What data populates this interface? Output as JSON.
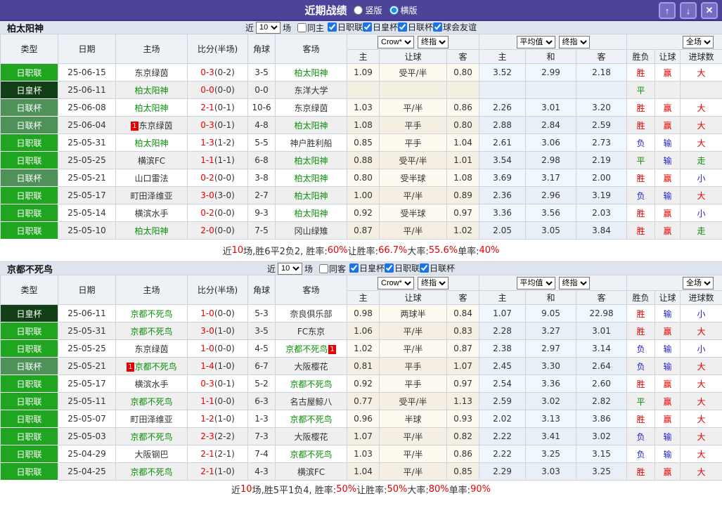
{
  "titlebar": {
    "title": "近期战绩",
    "vertical": {
      "label": "竖版",
      "checked": false
    },
    "horizontal": {
      "label": "横版",
      "checked": true
    },
    "buttons": {
      "up": "↑",
      "down": "↓",
      "close": "✕"
    }
  },
  "filter": {
    "prefix": "近",
    "count": "10",
    "suffix": "场"
  },
  "columns": {
    "type": "类型",
    "date": "日期",
    "home": "主场",
    "score": "比分(半场)",
    "corner": "角球",
    "away": "客场",
    "h": "主",
    "handicap": "让球",
    "a": "客",
    "h2": "主",
    "d": "和",
    "a2": "客",
    "result": "胜负",
    "handicap2": "让球",
    "goals": "进球数"
  },
  "dropdowns": {
    "odds_provider": "Crow*",
    "odds_final": "终指",
    "avg": "平均值",
    "avg_final": "终指",
    "fulltime": "全场"
  },
  "league_colors": {
    "日职联": "#1fa51f",
    "日皇杯": "#123f16",
    "日联杯": "#4e9159"
  },
  "colors": {
    "titlebar_purple": "#4d4399",
    "accent_blue": "#1a73e8",
    "win_red": "#e60000",
    "lose_blue": "#2222cc",
    "draw_green": "#0a8f0a",
    "odds_handicap_bg": "#fffaf0",
    "odds_europe_bg": "#f0f8ff"
  },
  "sections": [
    {
      "team": "柏太阳神",
      "same_label": "同主",
      "leagues": [
        "日职联",
        "日皇杯",
        "日联杯",
        "球会友谊"
      ],
      "rows": [
        {
          "lg": "日职联",
          "date": "25-06-15",
          "home": {
            "name": "东京绿茵",
            "focus": false
          },
          "score": "0-3",
          "half": "(0-2)",
          "corner": "3-5",
          "away": {
            "name": "柏太阳神",
            "focus": true
          },
          "o1": [
            "1.09",
            "受平/半",
            "0.80"
          ],
          "o2": [
            "3.52",
            "2.99",
            "2.18"
          ],
          "res": {
            "t": "胜",
            "c": "red"
          },
          "han": {
            "t": "赢",
            "c": "red"
          },
          "gl": {
            "t": "大",
            "c": "red"
          }
        },
        {
          "lg": "日皇杯",
          "date": "25-06-11",
          "home": {
            "name": "柏太阳神",
            "focus": true
          },
          "score": "0-0",
          "half": "(0-0)",
          "corner": "0-0",
          "away": {
            "name": "东洋大学",
            "focus": false
          },
          "o1": [
            "",
            "",
            ""
          ],
          "o2": [
            "",
            "",
            ""
          ],
          "res": {
            "t": "平",
            "c": "green"
          },
          "han": {
            "t": "",
            "c": ""
          },
          "gl": {
            "t": "",
            "c": ""
          }
        },
        {
          "lg": "日联杯",
          "date": "25-06-08",
          "home": {
            "name": "柏太阳神",
            "focus": true
          },
          "score": "2-1",
          "half": "(0-1)",
          "corner": "10-6",
          "away": {
            "name": "东京绿茵",
            "focus": false
          },
          "o1": [
            "1.03",
            "平/半",
            "0.86"
          ],
          "o2": [
            "2.26",
            "3.01",
            "3.20"
          ],
          "res": {
            "t": "胜",
            "c": "red"
          },
          "han": {
            "t": "赢",
            "c": "red"
          },
          "gl": {
            "t": "大",
            "c": "red"
          }
        },
        {
          "lg": "日联杯",
          "date": "25-06-04",
          "home": {
            "name": "东京绿茵",
            "focus": false,
            "card": {
              "pos": "before",
              "t": "1"
            }
          },
          "score": "0-3",
          "half": "(0-1)",
          "corner": "4-8",
          "away": {
            "name": "柏太阳神",
            "focus": true
          },
          "o1": [
            "1.08",
            "平手",
            "0.80"
          ],
          "o2": [
            "2.88",
            "2.84",
            "2.59"
          ],
          "res": {
            "t": "胜",
            "c": "red"
          },
          "han": {
            "t": "赢",
            "c": "red"
          },
          "gl": {
            "t": "大",
            "c": "red"
          }
        },
        {
          "lg": "日职联",
          "date": "25-05-31",
          "home": {
            "name": "柏太阳神",
            "focus": true
          },
          "score": "1-3",
          "half": "(1-2)",
          "corner": "5-5",
          "away": {
            "name": "神户胜利船",
            "focus": false
          },
          "o1": [
            "0.85",
            "平手",
            "1.04"
          ],
          "o2": [
            "2.61",
            "3.06",
            "2.73"
          ],
          "res": {
            "t": "负",
            "c": "blue"
          },
          "han": {
            "t": "输",
            "c": "blue"
          },
          "gl": {
            "t": "大",
            "c": "red"
          }
        },
        {
          "lg": "日职联",
          "date": "25-05-25",
          "home": {
            "name": "横滨FC",
            "focus": false
          },
          "score": "1-1",
          "half": "(1-1)",
          "corner": "6-8",
          "away": {
            "name": "柏太阳神",
            "focus": true
          },
          "o1": [
            "0.88",
            "受平/半",
            "1.01"
          ],
          "o2": [
            "3.54",
            "2.98",
            "2.19"
          ],
          "res": {
            "t": "平",
            "c": "green"
          },
          "han": {
            "t": "输",
            "c": "blue"
          },
          "gl": {
            "t": "走",
            "c": "green"
          }
        },
        {
          "lg": "日联杯",
          "date": "25-05-21",
          "home": {
            "name": "山口雷法",
            "focus": false
          },
          "score": "0-2",
          "half": "(0-0)",
          "corner": "3-8",
          "away": {
            "name": "柏太阳神",
            "focus": true
          },
          "o1": [
            "0.80",
            "受半球",
            "1.08"
          ],
          "o2": [
            "3.69",
            "3.17",
            "2.00"
          ],
          "res": {
            "t": "胜",
            "c": "red"
          },
          "han": {
            "t": "赢",
            "c": "red"
          },
          "gl": {
            "t": "小",
            "c": "blue"
          }
        },
        {
          "lg": "日职联",
          "date": "25-05-17",
          "home": {
            "name": "町田泽维亚",
            "focus": false
          },
          "score": "3-0",
          "half": "(3-0)",
          "corner": "2-7",
          "away": {
            "name": "柏太阳神",
            "focus": true
          },
          "o1": [
            "1.00",
            "平/半",
            "0.89"
          ],
          "o2": [
            "2.36",
            "2.96",
            "3.19"
          ],
          "res": {
            "t": "负",
            "c": "blue"
          },
          "han": {
            "t": "输",
            "c": "blue"
          },
          "gl": {
            "t": "大",
            "c": "red"
          }
        },
        {
          "lg": "日职联",
          "date": "25-05-14",
          "home": {
            "name": "横滨水手",
            "focus": false
          },
          "score": "0-2",
          "half": "(0-0)",
          "corner": "9-3",
          "away": {
            "name": "柏太阳神",
            "focus": true
          },
          "o1": [
            "0.92",
            "受半球",
            "0.97"
          ],
          "o2": [
            "3.36",
            "3.56",
            "2.03"
          ],
          "res": {
            "t": "胜",
            "c": "red"
          },
          "han": {
            "t": "赢",
            "c": "red"
          },
          "gl": {
            "t": "小",
            "c": "blue"
          }
        },
        {
          "lg": "日职联",
          "date": "25-05-10",
          "home": {
            "name": "柏太阳神",
            "focus": true
          },
          "score": "2-0",
          "half": "(0-0)",
          "corner": "7-5",
          "away": {
            "name": "冈山绿雉",
            "focus": false
          },
          "o1": [
            "0.87",
            "平/半",
            "1.02"
          ],
          "o2": [
            "2.05",
            "3.05",
            "3.84"
          ],
          "res": {
            "t": "胜",
            "c": "red"
          },
          "han": {
            "t": "赢",
            "c": "red"
          },
          "gl": {
            "t": "走",
            "c": "green"
          }
        }
      ],
      "summary": [
        {
          "t": "近"
        },
        {
          "t": "10",
          "red": true
        },
        {
          "t": "场,胜6平2负2, 胜率:"
        },
        {
          "t": "60%",
          "red": true
        },
        {
          "t": " 让胜率:"
        },
        {
          "t": "66.7%",
          "red": true
        },
        {
          "t": " 大率:"
        },
        {
          "t": "55.6%",
          "red": true
        },
        {
          "t": " 单率:"
        },
        {
          "t": "40%",
          "red": true
        }
      ]
    },
    {
      "team": "京都不死鸟",
      "same_label": "同客",
      "leagues": [
        "日皇杯",
        "日职联",
        "日联杯"
      ],
      "rows": [
        {
          "lg": "日皇杯",
          "date": "25-06-11",
          "home": {
            "name": "京都不死鸟",
            "focus": true
          },
          "score": "1-0",
          "half": "(0-0)",
          "corner": "5-3",
          "away": {
            "name": "奈良俱乐部",
            "focus": false
          },
          "o1": [
            "0.98",
            "两球半",
            "0.84"
          ],
          "o2": [
            "1.07",
            "9.05",
            "22.98"
          ],
          "res": {
            "t": "胜",
            "c": "red"
          },
          "han": {
            "t": "输",
            "c": "blue"
          },
          "gl": {
            "t": "小",
            "c": "blue"
          }
        },
        {
          "lg": "日职联",
          "date": "25-05-31",
          "home": {
            "name": "京都不死鸟",
            "focus": true
          },
          "score": "3-0",
          "half": "(1-0)",
          "corner": "3-5",
          "away": {
            "name": "FC东京",
            "focus": false
          },
          "o1": [
            "1.06",
            "平/半",
            "0.83"
          ],
          "o2": [
            "2.28",
            "3.27",
            "3.01"
          ],
          "res": {
            "t": "胜",
            "c": "red"
          },
          "han": {
            "t": "赢",
            "c": "red"
          },
          "gl": {
            "t": "大",
            "c": "red"
          }
        },
        {
          "lg": "日职联",
          "date": "25-05-25",
          "home": {
            "name": "东京绿茵",
            "focus": false
          },
          "score": "1-0",
          "half": "(0-0)",
          "corner": "4-5",
          "away": {
            "name": "京都不死鸟",
            "focus": true,
            "card": {
              "pos": "after",
              "t": "1"
            }
          },
          "o1": [
            "1.02",
            "平/半",
            "0.87"
          ],
          "o2": [
            "2.38",
            "2.97",
            "3.14"
          ],
          "res": {
            "t": "负",
            "c": "blue"
          },
          "han": {
            "t": "输",
            "c": "blue"
          },
          "gl": {
            "t": "小",
            "c": "blue"
          }
        },
        {
          "lg": "日联杯",
          "date": "25-05-21",
          "home": {
            "name": "京都不死鸟",
            "focus": true,
            "card": {
              "pos": "before",
              "t": "1"
            }
          },
          "score": "1-4",
          "half": "(1-0)",
          "corner": "6-7",
          "away": {
            "name": "大阪樱花",
            "focus": false
          },
          "o1": [
            "0.81",
            "平手",
            "1.07"
          ],
          "o2": [
            "2.45",
            "3.30",
            "2.64"
          ],
          "res": {
            "t": "负",
            "c": "blue"
          },
          "han": {
            "t": "输",
            "c": "blue"
          },
          "gl": {
            "t": "大",
            "c": "red"
          }
        },
        {
          "lg": "日职联",
          "date": "25-05-17",
          "home": {
            "name": "横滨水手",
            "focus": false
          },
          "score": "0-3",
          "half": "(0-1)",
          "corner": "5-2",
          "away": {
            "name": "京都不死鸟",
            "focus": true
          },
          "o1": [
            "0.92",
            "平手",
            "0.97"
          ],
          "o2": [
            "2.54",
            "3.36",
            "2.60"
          ],
          "res": {
            "t": "胜",
            "c": "red"
          },
          "han": {
            "t": "赢",
            "c": "red"
          },
          "gl": {
            "t": "大",
            "c": "red"
          }
        },
        {
          "lg": "日职联",
          "date": "25-05-11",
          "home": {
            "name": "京都不死鸟",
            "focus": true
          },
          "score": "1-1",
          "half": "(0-0)",
          "corner": "6-3",
          "away": {
            "name": "名古屋鲸八",
            "focus": false
          },
          "o1": [
            "0.77",
            "受平/半",
            "1.13"
          ],
          "o2": [
            "2.59",
            "3.02",
            "2.82"
          ],
          "res": {
            "t": "平",
            "c": "green"
          },
          "han": {
            "t": "赢",
            "c": "red"
          },
          "gl": {
            "t": "大",
            "c": "red"
          }
        },
        {
          "lg": "日职联",
          "date": "25-05-07",
          "home": {
            "name": "町田泽维亚",
            "focus": false
          },
          "score": "1-2",
          "half": "(1-0)",
          "corner": "1-3",
          "away": {
            "name": "京都不死鸟",
            "focus": true
          },
          "o1": [
            "0.96",
            "半球",
            "0.93"
          ],
          "o2": [
            "2.02",
            "3.13",
            "3.86"
          ],
          "res": {
            "t": "胜",
            "c": "red"
          },
          "han": {
            "t": "赢",
            "c": "red"
          },
          "gl": {
            "t": "大",
            "c": "red"
          }
        },
        {
          "lg": "日职联",
          "date": "25-05-03",
          "home": {
            "name": "京都不死鸟",
            "focus": true
          },
          "score": "2-3",
          "half": "(2-2)",
          "corner": "7-3",
          "away": {
            "name": "大阪樱花",
            "focus": false
          },
          "o1": [
            "1.07",
            "平/半",
            "0.82"
          ],
          "o2": [
            "2.22",
            "3.41",
            "3.02"
          ],
          "res": {
            "t": "负",
            "c": "blue"
          },
          "han": {
            "t": "输",
            "c": "blue"
          },
          "gl": {
            "t": "大",
            "c": "red"
          }
        },
        {
          "lg": "日职联",
          "date": "25-04-29",
          "home": {
            "name": "大阪钢巴",
            "focus": false
          },
          "score": "2-1",
          "half": "(2-1)",
          "corner": "7-4",
          "away": {
            "name": "京都不死鸟",
            "focus": true
          },
          "o1": [
            "1.03",
            "平/半",
            "0.86"
          ],
          "o2": [
            "2.22",
            "3.25",
            "3.15"
          ],
          "res": {
            "t": "负",
            "c": "blue"
          },
          "han": {
            "t": "输",
            "c": "blue"
          },
          "gl": {
            "t": "大",
            "c": "red"
          }
        },
        {
          "lg": "日职联",
          "date": "25-04-25",
          "home": {
            "name": "京都不死鸟",
            "focus": true
          },
          "score": "2-1",
          "half": "(1-0)",
          "corner": "4-3",
          "away": {
            "name": "横滨FC",
            "focus": false
          },
          "o1": [
            "1.04",
            "平/半",
            "0.85"
          ],
          "o2": [
            "2.29",
            "3.03",
            "3.25"
          ],
          "res": {
            "t": "胜",
            "c": "red"
          },
          "han": {
            "t": "赢",
            "c": "red"
          },
          "gl": {
            "t": "大",
            "c": "red"
          }
        }
      ],
      "summary": [
        {
          "t": "近"
        },
        {
          "t": "10",
          "red": true
        },
        {
          "t": "场,胜5平1负4, 胜率:"
        },
        {
          "t": "50%",
          "red": true
        },
        {
          "t": " 让胜率:"
        },
        {
          "t": "50%",
          "red": true
        },
        {
          "t": " 大率:"
        },
        {
          "t": "80%",
          "red": true
        },
        {
          "t": " 单率:"
        },
        {
          "t": "90%",
          "red": true
        }
      ]
    }
  ]
}
